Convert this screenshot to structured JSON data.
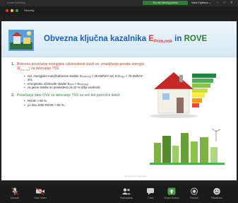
{
  "window": {
    "app_title": "Zoom Meeting",
    "recording_badge": "You are viewing screen",
    "view_options": "View Options ⌄",
    "controls": [
      "–",
      "□",
      "✕"
    ],
    "meeting_label": "Security"
  },
  "colors": {
    "dot_red": "#e53935",
    "dot_yellow": "#fbc02d",
    "dot_green": "#43a047",
    "toolbar_green": "#43a047"
  },
  "slide": {
    "title_main": "Obvezna ključna kazalnika ",
    "title_E": "E",
    "title_sub": "Prim,nob",
    "title_in": " in ",
    "title_rove": "ROVE",
    "item1_num": "1.",
    "item1_text": "Bistveno povečanje energijske učinkovitosti stavb  oz. zmanjšanje porabe energije (E",
    "item1_sub": "Prim,nob",
    "item1_tail": ") za delovanje TSS.",
    "item1_bullets": [
      "npr. energijsko manjšzahtevne stavbe: Eₕᵣᵢₘ,ₙₒᵦ < 35 kWh/m² an) in Eₖₐᵤᵤ < 75 kWh/m² an),",
      "energetsko učinkovite stavbe Eₕᵣᵢₘ < Eₕᵣᵢₘ,ₙₒᵦ",
      "za javne stavbe se predvideva za 10 % nižja vrednost."
    ],
    "item2_num": "2.",
    "item2_text": "Povečanje rabe OVE za delovanje TSS na več kot polovični delež:",
    "item2_bullets": [
      "ROVE > 50 %,",
      "po letu 2030 ROVE > 65 %."
    ],
    "footer": "Ministrstvo za infrastrukturo"
  },
  "toolbar": {
    "items": [
      {
        "label": "Unmute",
        "icon": "microphone-muted-icon"
      },
      {
        "label": "Start Video",
        "icon": "video-off-icon"
      },
      {
        "label": "Participants",
        "icon": "participants-icon"
      },
      {
        "label": "Chat",
        "icon": "chat-icon"
      },
      {
        "label": "Share Screen",
        "icon": "share-screen-icon"
      },
      {
        "label": "Record",
        "icon": "record-icon"
      },
      {
        "label": "Reactions",
        "icon": "reactions-icon"
      }
    ]
  }
}
